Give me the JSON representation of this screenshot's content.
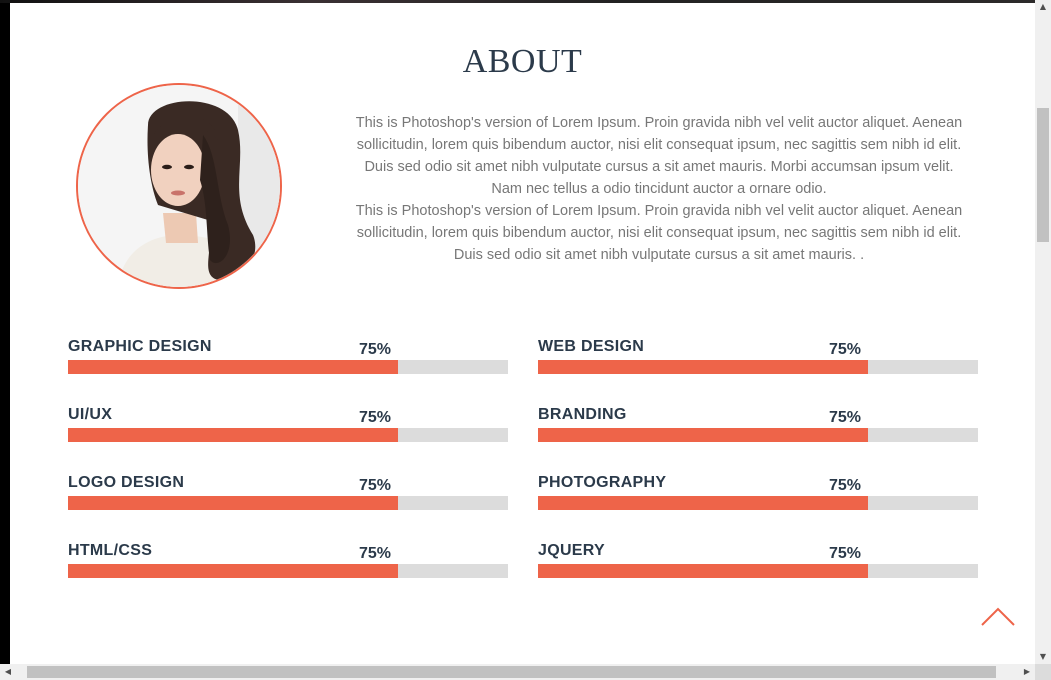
{
  "about": {
    "title": "ABOUT",
    "bio_paragraphs": [
      "This is Photoshop's version of Lorem Ipsum. Proin gravida nibh vel velit auctor aliquet. Aenean sollicitudin, lorem quis bibendum auctor, nisi elit consequat ipsum, nec sagittis sem nibh id elit. Duis sed odio sit amet nibh vulputate cursus a sit amet mauris. Morbi accumsan ipsum velit. Nam nec tellus a odio tincidunt auctor a ornare odio.",
      "This is Photoshop's version of Lorem Ipsum. Proin gravida nibh vel velit auctor aliquet. Aenean sollicitudin, lorem quis bibendum auctor, nisi elit consequat ipsum, nec sagittis sem nibh id elit. Duis sed odio sit amet nibh vulputate cursus a sit amet mauris. ."
    ]
  },
  "skills": {
    "left": [
      {
        "name": "GRAPHIC DESIGN",
        "percent_label": "75%",
        "fill": 0.75
      },
      {
        "name": "UI/UX",
        "percent_label": "75%",
        "fill": 0.75
      },
      {
        "name": "LOGO DESIGN",
        "percent_label": "75%",
        "fill": 0.75
      },
      {
        "name": "HTML/CSS",
        "percent_label": "75%",
        "fill": 0.75
      }
    ],
    "right": [
      {
        "name": "WEB DESIGN",
        "percent_label": "75%",
        "fill": 0.75
      },
      {
        "name": "BRANDING",
        "percent_label": "75%",
        "fill": 0.75
      },
      {
        "name": "PHOTOGRAPHY",
        "percent_label": "75%",
        "fill": 0.75
      },
      {
        "name": "JQUERY",
        "percent_label": "75%",
        "fill": 0.75
      }
    ]
  },
  "colors": {
    "accent": "#ee6449",
    "track": "#dcdcdc",
    "heading": "#2b3a4a",
    "body_text": "#777777"
  },
  "icons": {
    "scroll_top": "chevron-up-icon",
    "scroll_up": "triangle-up-icon",
    "scroll_down": "triangle-down-icon",
    "scroll_left": "triangle-left-icon",
    "scroll_right": "triangle-right-icon"
  }
}
